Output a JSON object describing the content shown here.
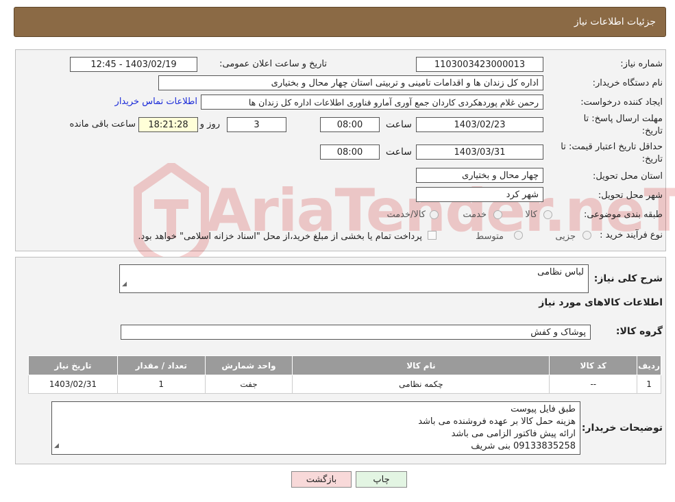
{
  "header": {
    "title": "جزئیات اطلاعات نیاز"
  },
  "form": {
    "need_number_label": "شماره نیاز:",
    "need_number": "1103003423000013",
    "announce_label": "تاریخ و ساعت اعلان عمومی:",
    "announce_value": "1403/02/19 - 12:45",
    "buyer_org_label": "نام دستگاه خریدار:",
    "buyer_org": "اداره کل زندان ها و اقدامات تامینی و تربیتی استان چهار محال و بختیاری",
    "creator_label": "ایجاد کننده درخواست:",
    "creator": "رحمن غلام پوردهکردی کاردان جمع آوری آمارو فناوری اطلاعات اداره کل زندان ها",
    "contact_link": "اطلاعات تماس خریدار",
    "deadline_label_1": "مهلت ارسال پاسخ: تا",
    "deadline_label_2": "تاریخ:",
    "deadline_date": "1403/02/23",
    "time_label": "ساعت",
    "deadline_time": "08:00",
    "days_value": "3",
    "days_label": "روز و",
    "remaining_time": "18:21:28",
    "remaining_label": "ساعت باقی مانده",
    "validity_label_1": "حداقل تاریخ اعتبار قیمت: تا",
    "validity_label_2": "تاریخ:",
    "validity_date": "1403/03/31",
    "validity_time_label": "ساعت",
    "validity_time": "08:00",
    "province_label": "استان محل تحویل:",
    "province": "چهار محال و بختیاری",
    "city_label": "شهر محل تحویل:",
    "city": "شهر کرد",
    "category_label": "طبقه بندی موضوعی:",
    "category_options": [
      "کالا",
      "خدمت",
      "کالا/خدمت"
    ],
    "process_label": "نوع فرآیند خرید :",
    "process_options": [
      "جزیی",
      "متوسط"
    ],
    "payment_note": "پرداخت تمام یا بخشی از مبلغ خرید،از محل \"اسناد خزانه اسلامی\" خواهد بود."
  },
  "details": {
    "summary_label": "شرح کلی نیاز:",
    "summary": "لباس نظامی",
    "goods_info_title": "اطلاعات کالاهای مورد نیاز",
    "group_label": "گروه کالا:",
    "group": "پوشاک و کفش",
    "table": {
      "headers": [
        "ردیف",
        "کد کالا",
        "نام کالا",
        "واحد شمارش",
        "تعداد / مقدار",
        "تاریخ نیاز"
      ],
      "rows": [
        [
          "1",
          "--",
          "چکمه نظامی",
          "جفت",
          "1",
          "1403/02/31"
        ]
      ]
    },
    "buyer_notes_label": "توضیحات خریدار:",
    "buyer_notes": [
      "طبق فایل پیوست",
      "هزینه حمل کالا بر عهده فروشنده می باشد",
      "ارائه پیش فاکتور الزامی می باشد",
      "09133835258 بنی شریف"
    ]
  },
  "buttons": {
    "print": "چاپ",
    "back": "بازگشت"
  },
  "watermark": {
    "text": "AriaTender.neT"
  },
  "colors": {
    "header_bg": "#8b6a45",
    "table_header": "#9b9b9b",
    "link": "#1a2ad8",
    "back_btn_bg": "#f8d9d9",
    "print_btn_bg": "#e3f5e3"
  }
}
